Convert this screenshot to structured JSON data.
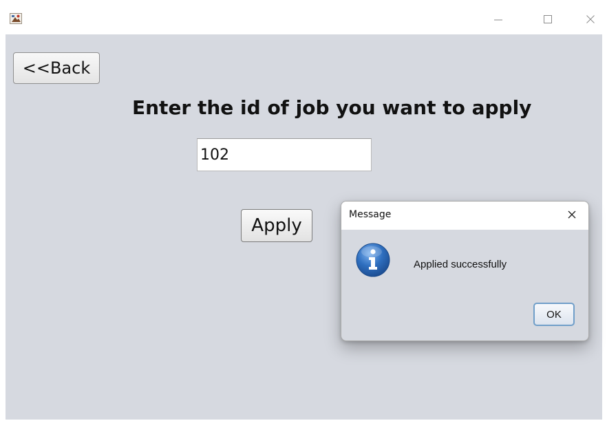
{
  "window": {
    "app_icon": "java-app-icon",
    "controls": {
      "minimize_icon": "minimize-icon",
      "maximize_icon": "maximize-icon",
      "close_icon": "close-icon"
    }
  },
  "form": {
    "back_label": "<<Back",
    "heading": "Enter the id of job you want to apply",
    "job_id_value": "102",
    "apply_label": "Apply"
  },
  "dialog": {
    "title": "Message",
    "close_icon": "close-icon",
    "icon": "info-icon",
    "message": "Applied successfully",
    "ok_label": "OK"
  },
  "colors": {
    "panel_background": "#d6d9e0",
    "titlebar_background": "#ffffff",
    "info_icon_blue": "#2f6fbf",
    "ok_focus_border": "#6f9ec9"
  }
}
